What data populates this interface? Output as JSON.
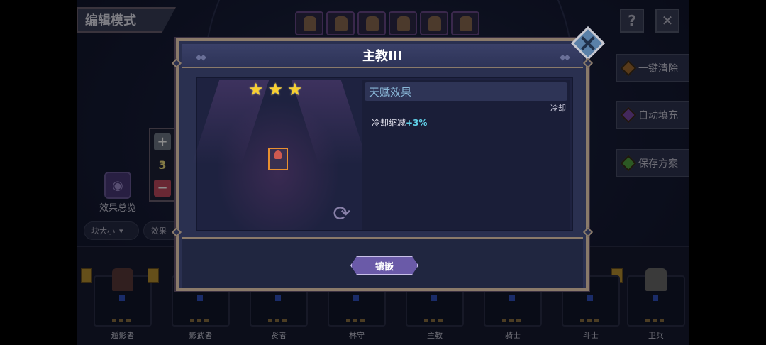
{
  "header": {
    "mode_label": "编辑模式",
    "help_icon": "question-icon",
    "close_icon": "close-icon"
  },
  "side_actions": [
    {
      "label": "一键清除",
      "gem_color": "#a06a30"
    },
    {
      "label": "自动填充",
      "gem_color": "#7a4aa8"
    },
    {
      "label": "保存方案",
      "gem_color": "#50a040"
    }
  ],
  "counter": {
    "value": "3",
    "plus_icon": "plus-icon",
    "minus_icon": "minus-icon"
  },
  "effects_overview": {
    "label": "效果总览"
  },
  "filters": [
    {
      "label": "块大小"
    },
    {
      "label": "效果"
    }
  ],
  "slots": [
    {
      "name": "遁影者"
    },
    {
      "name": "影武者"
    },
    {
      "name": "贤者"
    },
    {
      "name": "林守"
    },
    {
      "name": "主教"
    },
    {
      "name": "骑士"
    },
    {
      "name": "斗士"
    },
    {
      "name": "卫兵"
    }
  ],
  "modal": {
    "title": "主教III",
    "stars": 3,
    "talent_header": "天赋效果",
    "cooldown_tag": "冷却",
    "effect_text": "冷却缩减",
    "effect_value": "+3%",
    "inlay_button": "镶嵌"
  },
  "colors": {
    "star": "#f8d030",
    "accent_purple": "#6a5aa8",
    "effect_value": "#60d0e8",
    "frame": "#8a7a6a"
  }
}
